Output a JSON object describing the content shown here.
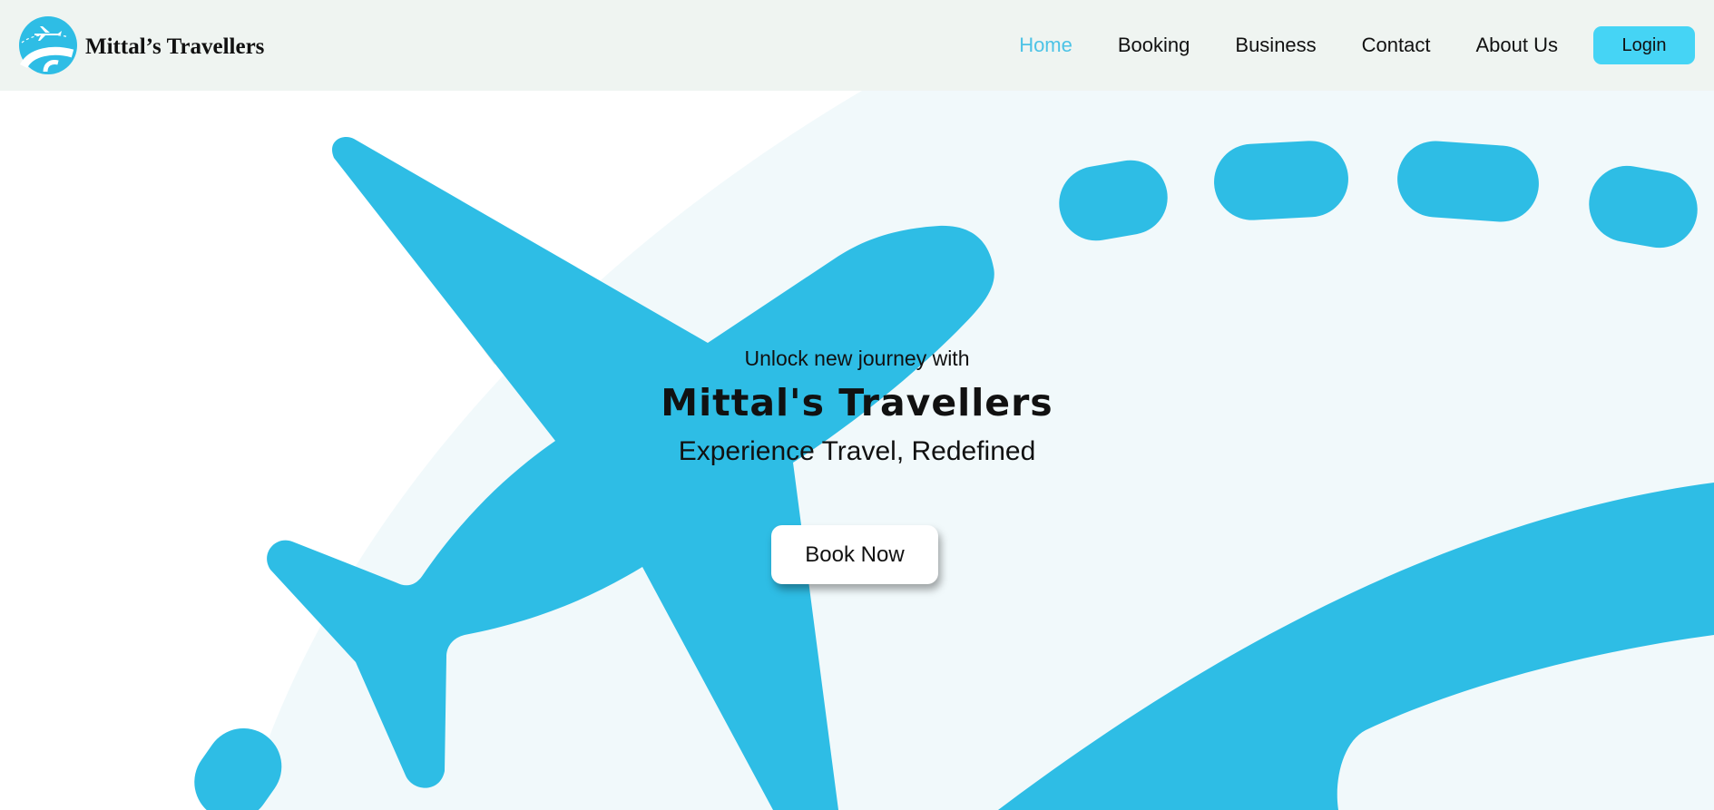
{
  "colors": {
    "accent": "#2ebde5",
    "nav_background": "#eff4f1",
    "nav_active": "#4cc3e6",
    "login_button": "#45d4f5",
    "hero_arc": "#f1f9fb"
  },
  "header": {
    "brand_name": "Mittal’s Travellers",
    "logo_icon": "airplane-globe-logo",
    "nav_items": [
      {
        "label": "Home",
        "active": true
      },
      {
        "label": "Booking",
        "active": false
      },
      {
        "label": "Business",
        "active": false
      },
      {
        "label": "Contact",
        "active": false
      },
      {
        "label": "About Us",
        "active": false
      }
    ],
    "login_label": "Login"
  },
  "hero": {
    "tagline": "Unlock new journey with",
    "title": "Mittal's Travellers",
    "subtitle": "Experience Travel, Redefined",
    "book_button_label": "Book Now",
    "illustration_icon": "airplane-icon"
  }
}
